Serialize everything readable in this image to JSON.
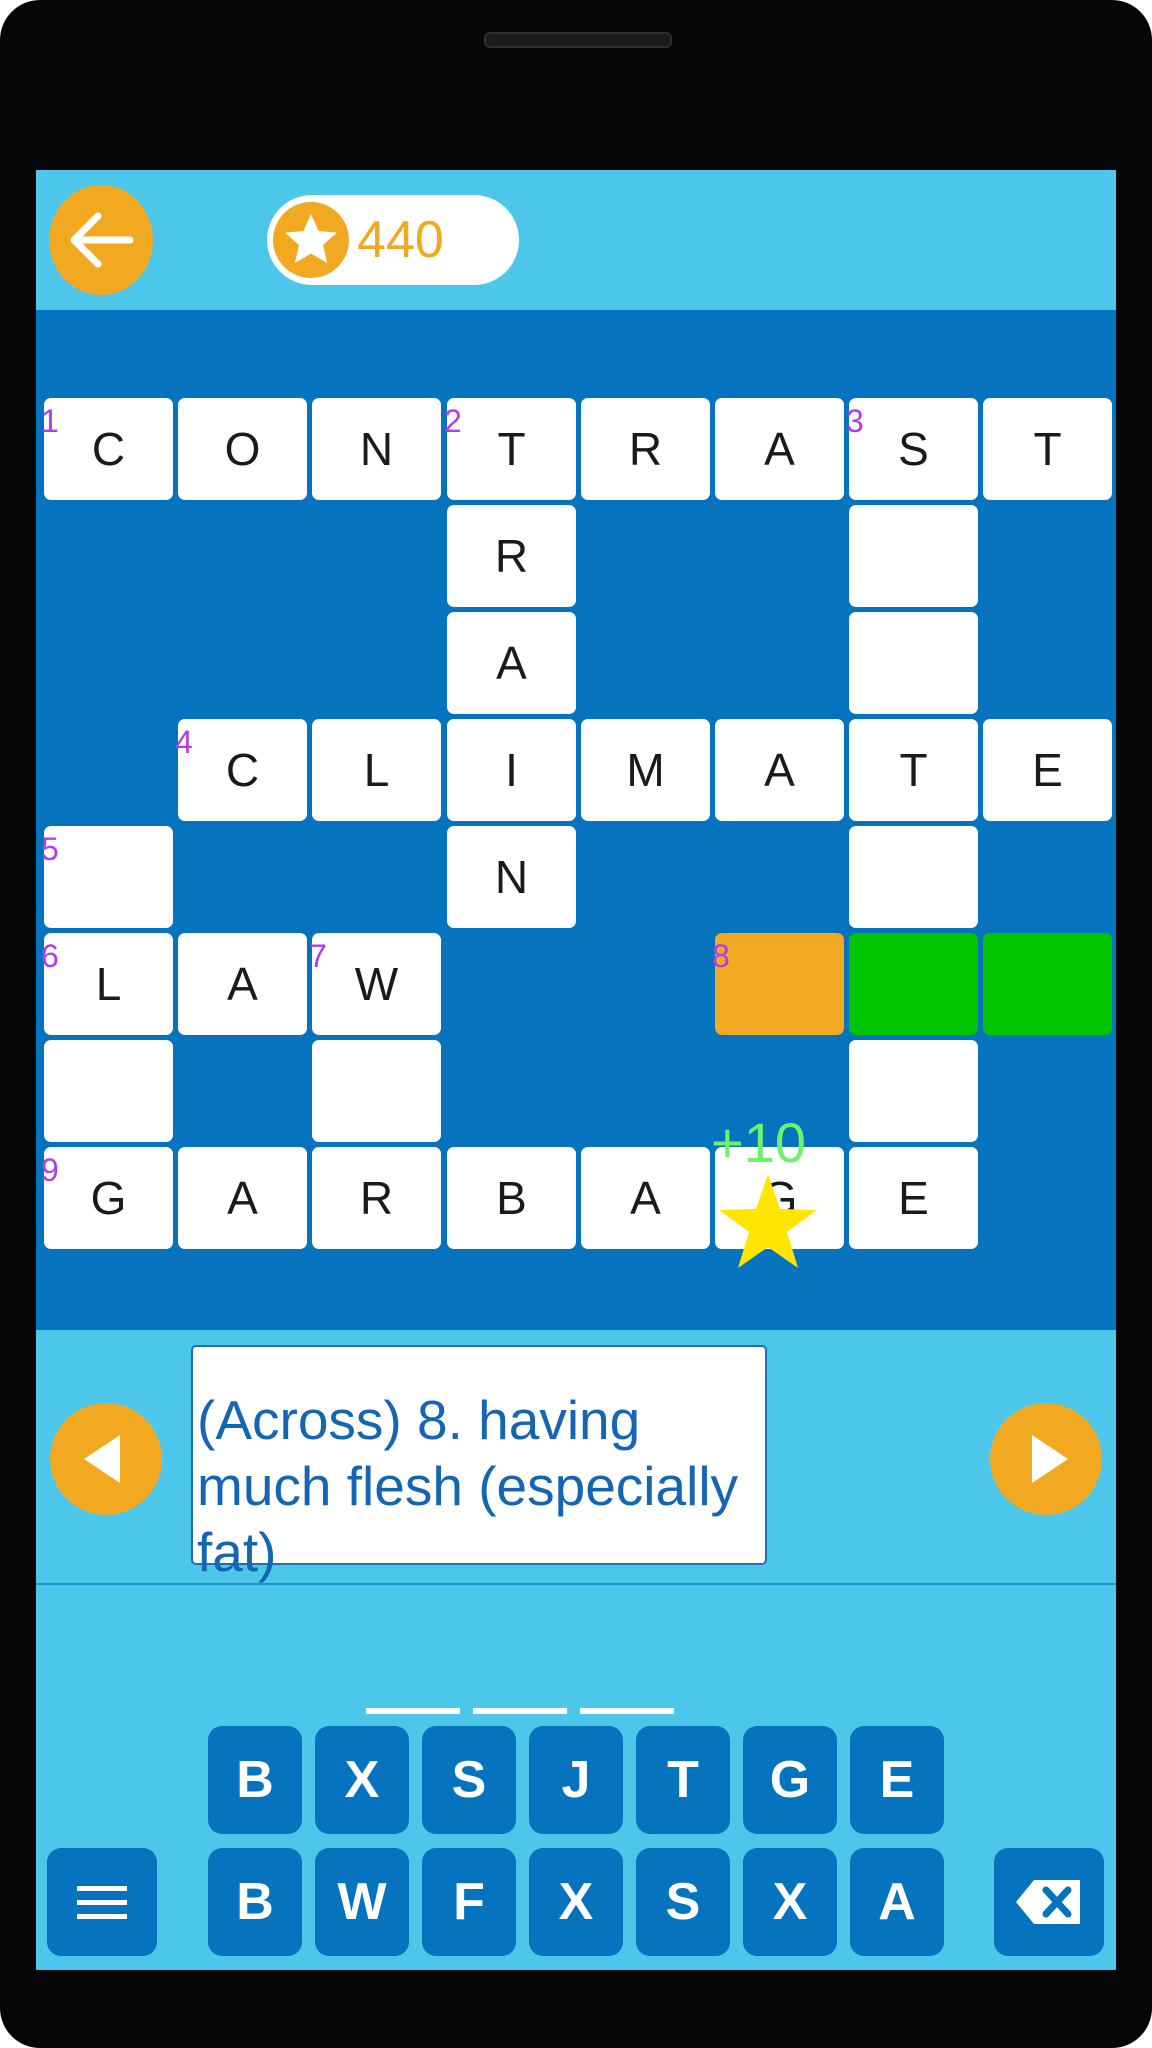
{
  "header": {
    "back_icon": "arrow-left-icon",
    "score": "440",
    "score_icon": "star-icon"
  },
  "board": {
    "cells": [
      {
        "c": 0,
        "r": 0,
        "l": "C",
        "n": "1"
      },
      {
        "c": 1,
        "r": 0,
        "l": "O"
      },
      {
        "c": 2,
        "r": 0,
        "l": "N"
      },
      {
        "c": 3,
        "r": 0,
        "l": "T",
        "n": "2"
      },
      {
        "c": 4,
        "r": 0,
        "l": "R"
      },
      {
        "c": 5,
        "r": 0,
        "l": "A"
      },
      {
        "c": 6,
        "r": 0,
        "l": "S",
        "n": "3"
      },
      {
        "c": 7,
        "r": 0,
        "l": "T"
      },
      {
        "c": 3,
        "r": 1,
        "l": "R"
      },
      {
        "c": 6,
        "r": 1,
        "l": ""
      },
      {
        "c": 3,
        "r": 2,
        "l": "A"
      },
      {
        "c": 6,
        "r": 2,
        "l": ""
      },
      {
        "c": 1,
        "r": 3,
        "l": "C",
        "n": "4"
      },
      {
        "c": 2,
        "r": 3,
        "l": "L"
      },
      {
        "c": 3,
        "r": 3,
        "l": "I"
      },
      {
        "c": 4,
        "r": 3,
        "l": "M"
      },
      {
        "c": 5,
        "r": 3,
        "l": "A"
      },
      {
        "c": 6,
        "r": 3,
        "l": "T"
      },
      {
        "c": 7,
        "r": 3,
        "l": "E"
      },
      {
        "c": 0,
        "r": 4,
        "l": "",
        "n": "5"
      },
      {
        "c": 3,
        "r": 4,
        "l": "N"
      },
      {
        "c": 6,
        "r": 4,
        "l": ""
      },
      {
        "c": 0,
        "r": 5,
        "l": "L",
        "n": "6"
      },
      {
        "c": 1,
        "r": 5,
        "l": "A"
      },
      {
        "c": 2,
        "r": 5,
        "l": "W",
        "n": "7"
      },
      {
        "c": 5,
        "r": 5,
        "l": "",
        "n": "8",
        "s": "active"
      },
      {
        "c": 6,
        "r": 5,
        "l": "",
        "s": "word"
      },
      {
        "c": 7,
        "r": 5,
        "l": "",
        "s": "word"
      },
      {
        "c": 0,
        "r": 6,
        "l": ""
      },
      {
        "c": 2,
        "r": 6,
        "l": ""
      },
      {
        "c": 6,
        "r": 6,
        "l": ""
      },
      {
        "c": 0,
        "r": 7,
        "l": "G",
        "n": "9"
      },
      {
        "c": 1,
        "r": 7,
        "l": "A"
      },
      {
        "c": 2,
        "r": 7,
        "l": "R"
      },
      {
        "c": 3,
        "r": 7,
        "l": "B"
      },
      {
        "c": 4,
        "r": 7,
        "l": "A"
      },
      {
        "c": 5,
        "r": 7,
        "l": "G"
      },
      {
        "c": 6,
        "r": 7,
        "l": "E"
      }
    ],
    "bonus_text": "+10"
  },
  "clue": {
    "text": "(Across) 8. having much flesh (especially fat)",
    "prev_icon": "triangle-left-icon",
    "next_icon": "triangle-right-icon"
  },
  "answer_blanks": 3,
  "keyboard": {
    "row1": [
      "B",
      "X",
      "S",
      "J",
      "T",
      "G",
      "E"
    ],
    "row2": [
      "B",
      "W",
      "F",
      "X",
      "S",
      "X",
      "A"
    ],
    "menu_icon": "hamburger-menu-icon",
    "delete_icon": "backspace-icon"
  }
}
